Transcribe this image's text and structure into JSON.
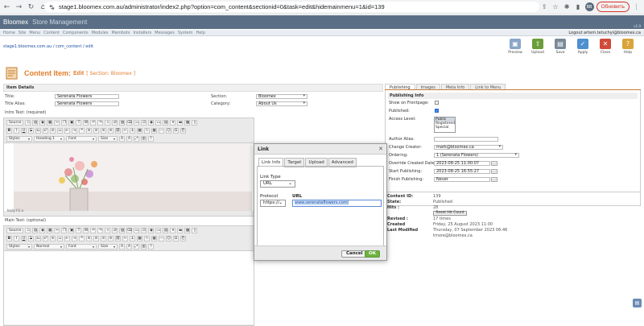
{
  "browser": {
    "url": "stage1.bloomex.com.au/administrator/index2.php?option=com_content&sectionid=0&task=edit&hidemainmenu=1&id=139",
    "update_label": "Обновить",
    "avatar_initials": "ВВ"
  },
  "admin": {
    "brand": "Bloomex",
    "brand_sub": "Store Management",
    "version": "v1.0",
    "menu": [
      "Home",
      "Site",
      "Menu",
      "Content",
      "Components",
      "Modules",
      "Mambots",
      "Installers",
      "Messages",
      "System",
      "Help"
    ],
    "logout": "Logout artem.tetuchyi@bloomex.ca",
    "breadcrumb": "stage1.bloomex.com.au / com_content / edit",
    "toolbar": [
      {
        "label": "Preview",
        "icon": "preview-icon",
        "color": "#8aa6c8"
      },
      {
        "label": "Upload",
        "icon": "upload-icon",
        "color": "#6b9d3a"
      },
      {
        "label": "Save",
        "icon": "save-icon",
        "color": "#7a8a9a"
      },
      {
        "label": "Apply",
        "icon": "apply-icon",
        "color": "#4e8fcf"
      },
      {
        "label": "Close",
        "icon": "close-icon",
        "color": "#d04b3a"
      },
      {
        "label": "Help",
        "icon": "help-icon",
        "color": "#d9a53a"
      }
    ],
    "page_title": "Content Item:",
    "page_mode": "Edit",
    "page_section": "[ Section: Bloomex ]"
  },
  "item": {
    "section_head": "Item Details",
    "title_label": "Title:",
    "title_value": "Serenata Flowers",
    "alias_label": "Title Alias:",
    "alias_value": "Serenata Flowers",
    "section_label": "Section:",
    "section_value": "Bloomex",
    "category_label": "Category:",
    "category_value": "About Us",
    "intro_label": "Intro Text: (required)",
    "main_label": "Main Text: (optional)",
    "path_label": "body  h1  a"
  },
  "editor": {
    "source": "Source",
    "styles": "Styles",
    "format_intro": "Heading 1",
    "format_main": "Normal",
    "font": "Font",
    "size": "Size"
  },
  "right": {
    "tabs": [
      "Publishing",
      "Images",
      "Meta Info",
      "Link to Menu"
    ],
    "pane_title": "Publishing Info",
    "frontpage_label": "Show on Frontpage:",
    "published_label": "Published:",
    "access_label": "Access Level:",
    "access_options": [
      "Public",
      "Registered",
      "Special"
    ],
    "author_alias_label": "Author Alias:",
    "creator_label": "Change Creator:",
    "creator_value": "mark@bloomex.ca",
    "ordering_label": "Ordering:",
    "ordering_value": "1 (Serenata Flowers)",
    "created_label": "Override Created Date:",
    "created_value": "2023-08-25 11:00:07",
    "start_label": "Start Publishing:",
    "start_value": "2023-08-25 16:55:27",
    "finish_label": "Finish Publishing:",
    "finish_value": "Never"
  },
  "info": {
    "content_id_label": "Content ID:",
    "content_id": "139",
    "state_label": "State:",
    "state": "Published",
    "hits_label": "Hits :",
    "hits": "28",
    "reset_label": "Reset Hit Count",
    "revised_label": "Revised :",
    "revised": "17 times",
    "created_label": "Created",
    "created": "Friday, 25 August 2023 11:00",
    "modified_label": "Last Modified",
    "modified": "Thursday, 07 September 2023 06:46",
    "modified_by": "tmore@bloomex.ca"
  },
  "dialog": {
    "title": "Link",
    "tabs": [
      "Link Info",
      "Target",
      "Upload",
      "Advanced"
    ],
    "link_type_label": "Link Type",
    "link_type_value": "URL",
    "protocol_label": "Protocol",
    "protocol_value": "https://",
    "url_label": "URL",
    "url_value": "www.serenataflowers.com/",
    "cancel": "Cancel",
    "ok": "OK"
  }
}
